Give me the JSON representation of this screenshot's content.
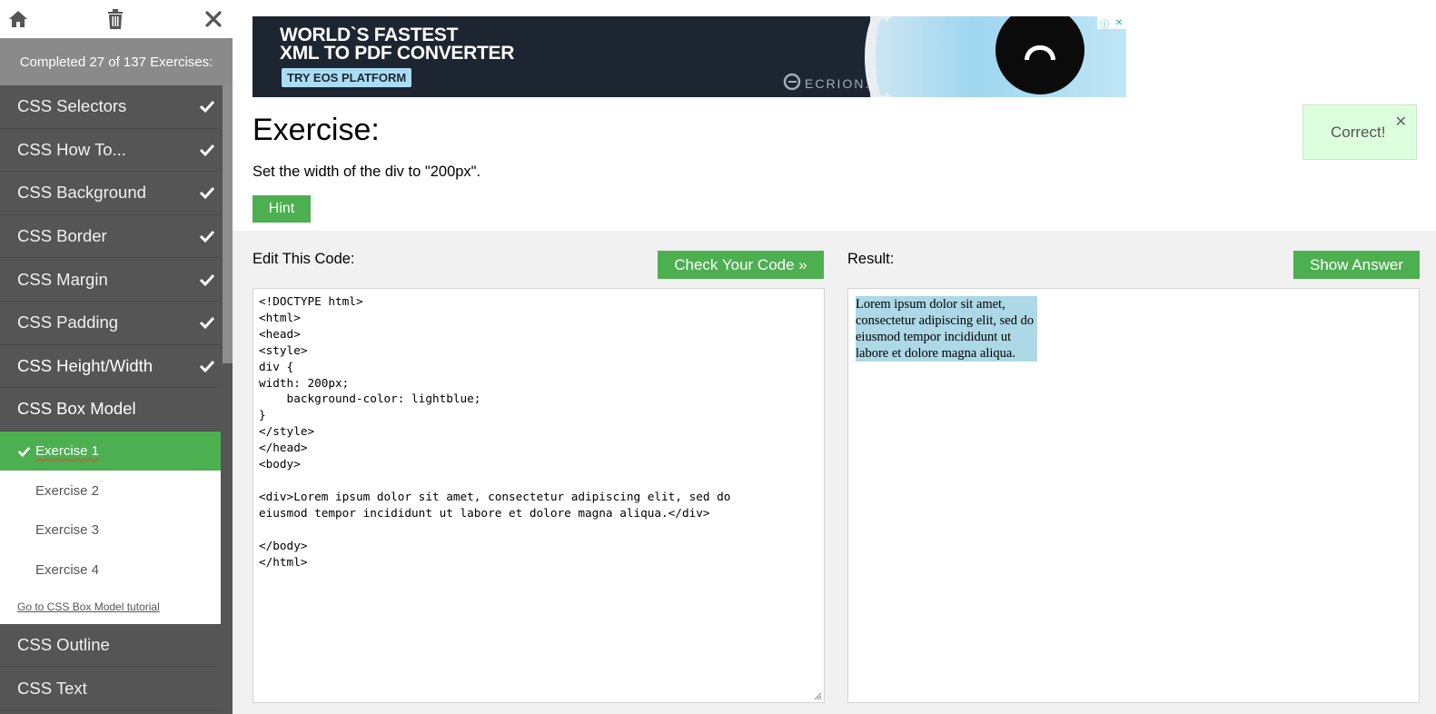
{
  "sidebar": {
    "progress_text": "Completed 27 of 137 Exercises:",
    "icons": [
      "home-icon",
      "trash-icon",
      "close-icon"
    ],
    "items": [
      {
        "label": "CSS Selectors",
        "done": true
      },
      {
        "label": "CSS How To...",
        "done": true
      },
      {
        "label": "CSS Background",
        "done": true
      },
      {
        "label": "CSS Border",
        "done": true
      },
      {
        "label": "CSS Margin",
        "done": true
      },
      {
        "label": "CSS Padding",
        "done": true
      },
      {
        "label": "CSS Height/Width",
        "done": true
      },
      {
        "label": "CSS Box Model",
        "done": false
      }
    ],
    "submenu": {
      "items": [
        "Exercise 1",
        "Exercise 2",
        "Exercise 3",
        "Exercise 4"
      ],
      "active_index": 0,
      "tutorial_link": "Go to CSS Box Model tutorial"
    },
    "after_items": [
      "CSS Outline",
      "CSS Text"
    ]
  },
  "ad": {
    "line1": "WORLD`S FASTEST",
    "line2": "XML TO PDF CONVERTER",
    "cta": "TRY EOS PLATFORM",
    "brand": "ECRION."
  },
  "exercise": {
    "title": "Exercise:",
    "description": "Set the width of the div to \"200px\".",
    "hint_label": "Hint"
  },
  "notification": {
    "text": "Correct!",
    "close": "✕"
  },
  "editor": {
    "label": "Edit This Code:",
    "check_button": "Check Your Code »",
    "lines": [
      "<!DOCTYPE html>",
      "<html>",
      "<head>",
      "<style>",
      "div {",
      "width: 200px;",
      "    background-color: lightblue;",
      "}",
      "</style>",
      "</head>",
      "<body>",
      "",
      "<div>Lorem ipsum dolor sit amet, consectetur adipiscing elit, sed do",
      "eiusmod tempor incididunt ut labore et dolore magna aliqua.</div>",
      "",
      "</body>",
      "</html>"
    ]
  },
  "result": {
    "label": "Result:",
    "answer_button": "Show Answer",
    "content": "Lorem ipsum dolor sit amet, consectetur adipiscing elit, sed do eiusmod tempor incididunt ut labore et dolore magna aliqua.",
    "div_bg": "lightblue"
  },
  "colors": {
    "accent": "#4CAF50",
    "sidebar_bg": "#555555",
    "progress_bg": "#8a8a8a",
    "notify_bg": "#ddffdd",
    "workarea_bg": "#f1f1f1"
  }
}
